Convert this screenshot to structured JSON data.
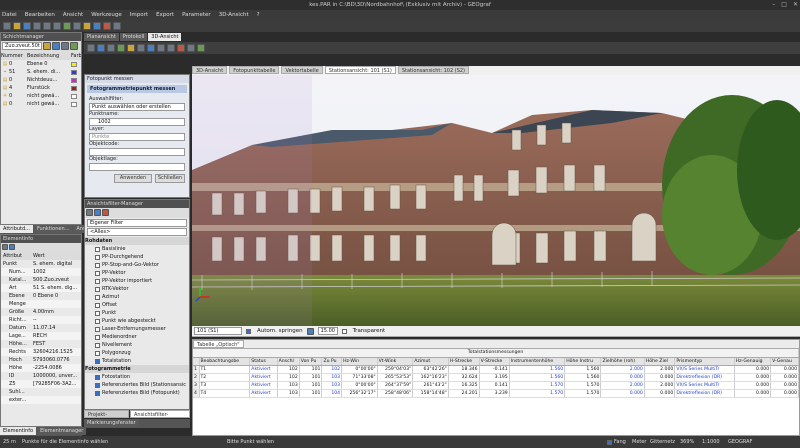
{
  "window": {
    "title": "kes.PAR in C:\\BD\\3D\\Nordbahnhof\\ (Exklusiv mit Archiv) - GEOgraf",
    "controls": [
      "–",
      "□",
      "✕"
    ]
  },
  "menu": [
    "Datei",
    "Bearbeiten",
    "Ansicht",
    "Werkzeuge",
    "Import",
    "Export",
    "Parameter",
    "3D-Ansicht",
    "?"
  ],
  "schichtmanager": {
    "title": "Schichtmanager",
    "combo": "Zuo.zveut.50t",
    "columns": [
      "Nummer",
      "Bezeichnung",
      "Farb"
    ],
    "rows": [
      {
        "num": "0",
        "name": "Ebene 0",
        "color": "#f2f207",
        "icon": "layer"
      },
      {
        "num": "51",
        "name": "S. ehem. di...",
        "color": "#2e3cd8",
        "icon": "pin"
      },
      {
        "num": "0",
        "name": "Nichtdeuu...",
        "color": "#d822d8",
        "icon": "layer"
      },
      {
        "num": "4",
        "name": "Flurstück",
        "color": "#9c2222",
        "icon": "layer"
      },
      {
        "num": "0",
        "name": "nicht gewä...",
        "color": "#ffffff",
        "icon": "bulb"
      },
      {
        "num": "0",
        "name": "nicht gewä...",
        "color": "#ffffff",
        "icon": "layer"
      }
    ]
  },
  "lefttabs": [
    "Attributd...",
    "Funktionen...",
    "Ansichtsf..."
  ],
  "elementinfo": {
    "title": "Elementinfo",
    "columns": [
      "Attribut",
      "Wert"
    ],
    "rows": [
      {
        "attr": "Punkt",
        "val": "S. ehem. digital"
      },
      {
        "attr": "Num...",
        "val": "1002"
      },
      {
        "attr": "Katal...",
        "val": "500.Zuo.zveut"
      },
      {
        "attr": "Art",
        "val": "51 S. ehem. dig..."
      },
      {
        "attr": "Ebene",
        "val": "0 Ebene 0"
      },
      {
        "attr": "Menge",
        "val": ""
      },
      {
        "attr": "Größe",
        "val": "4.00mm"
      },
      {
        "attr": "Richt...",
        "val": "--"
      },
      {
        "attr": "Datum",
        "val": "11.07.14"
      },
      {
        "attr": "Lage...",
        "val": "RECH"
      },
      {
        "attr": "Höhe...",
        "val": "FEST"
      },
      {
        "attr": "Rechts",
        "val": "32604216.1525"
      },
      {
        "attr": "Hoch",
        "val": "5793060.0776"
      },
      {
        "attr": "Höhe",
        "val": "-2254.0086"
      },
      {
        "attr": "ID",
        "val": "1000000, unver..."
      },
      {
        "attr": "Z5",
        "val": "[79285F06-3A2..."
      },
      {
        "attr": "Suhl...",
        "val": ""
      },
      {
        "attr": "exter...",
        "val": ""
      }
    ]
  },
  "bottomlefttabs": [
    "Elementinfo",
    "Elementmanager"
  ],
  "fotopunkt": {
    "title": "Fotopunkt messen",
    "section": "Fotogrammetriepunkt messen",
    "auswahl_label": "Auswahlfilter:",
    "auswahl": "Punkt auswählen oder erstellen",
    "punktname_label": "Punktname:",
    "punktname": "1002",
    "layer_label": "Layer:",
    "layer": "Punkte",
    "objektcode_label": "Objektcode:",
    "objektcode": "",
    "objektlage_label": "Objektlage:",
    "objektlage": "",
    "anwenden": "Anwenden",
    "schliessen": "Schließen"
  },
  "ansichtsfilter": {
    "title": "Ansichtsfilter-Manager",
    "filter": "Eigener Filter",
    "alles": "<Alles>",
    "group1": "Rohdaten",
    "items": [
      {
        "label": "Basislinie",
        "on": false
      },
      {
        "label": "PP-Durchgehend",
        "on": false
      },
      {
        "label": "PP-Stop-and-Go-Vektor",
        "on": false
      },
      {
        "label": "PP-Vektor",
        "on": false
      },
      {
        "label": "PP-Vektor importiert",
        "on": false
      },
      {
        "label": "RTK-Vektor",
        "on": false
      },
      {
        "label": "Azimut",
        "on": false
      },
      {
        "label": "Offset",
        "on": false
      },
      {
        "label": "Punkt",
        "on": false
      },
      {
        "label": "Punkt wie abgesteckt",
        "on": false
      },
      {
        "label": "Laser-Entfernungsmesser",
        "on": false
      },
      {
        "label": "Medienordner",
        "on": false
      },
      {
        "label": "Nivellement",
        "on": false
      },
      {
        "label": "Polygonzug",
        "on": false
      },
      {
        "label": "Totalstation",
        "on": true
      }
    ],
    "group2": "Fotogrammetrie",
    "items2": [
      {
        "label": "Fotostation",
        "on": true
      },
      {
        "label": "Referenziertes Bild (Stationsansic",
        "on": true
      },
      {
        "label": "Referenziertes Bild (Fotopunkt)",
        "on": true
      }
    ],
    "tabs": [
      "Projekt-Explorer",
      "Ansichtsfilter-Manager"
    ]
  },
  "doctabs": [
    "Planansicht",
    "Protokoll",
    "3D-Ansicht"
  ],
  "viewtabs": [
    "3D-Ansicht",
    "Fotopunkttabelle",
    "Vektortabelle",
    "Stationsansicht: 101 (S1)",
    "Stationsansicht: 102 (S2)"
  ],
  "imagecontrols": {
    "station": "101 (S1)",
    "autom_springen": "Autom. springen",
    "zoom": "15.00",
    "transparent": "Transparent"
  },
  "tabelle": {
    "tab": "Tabelle „Optisch\"",
    "group_header": "Totalstationsmessungen",
    "columns": [
      "Beobachtungsbe",
      "Status",
      "Anschl",
      "Von Pu",
      "Zu Pu",
      "Hz-Win",
      "Vt-Wink",
      "Azimut",
      "H-Strecke",
      "V-Strecke",
      "Instrumentenhöhe",
      "Höhe Instru",
      "Zielhöhe (roh)",
      "Höhe Ziel",
      "Prismentyp",
      "Hz-Genauig",
      "V-Genau"
    ],
    "rows": [
      {
        "sel": "1",
        "c": [
          "T1",
          "Aktiviert",
          "102",
          "101",
          "102",
          "0°00'00\"",
          "259°04'03\"",
          "63°42'26\"",
          "18.346",
          "-0.141",
          "1.560",
          "1.560",
          "2.000",
          "2.000",
          "VX/S Series MultiTr",
          "0.000",
          "0.000"
        ]
      },
      {
        "sel": "2",
        "c": [
          "T2",
          "Aktiviert",
          "102",
          "101",
          "103",
          "71°33'08\"",
          "265°53'53\"",
          "162°16'23\"",
          "32.624",
          "3.195",
          "1.560",
          "1.560",
          "0.000",
          "0.000",
          "Direktreflexion (DR)",
          "0.000",
          "0.000"
        ]
      },
      {
        "sel": "3",
        "c": [
          "T3",
          "Aktiviert",
          "103",
          "101",
          "103",
          "0°00'00\"",
          "264°37'59\"",
          "261°43'2\"",
          "16.325",
          "0.141",
          "1.570",
          "1.570",
          "2.000",
          "2.000",
          "VX/S Series MultiTr",
          "0.000",
          "0.000"
        ]
      },
      {
        "sel": "4",
        "c": [
          "T4",
          "Aktiviert",
          "103",
          "101",
          "104",
          "256°32'17\"",
          "258°48'06\"",
          "158°14'48\"",
          "24.201",
          "3.239",
          "1.570",
          "1.570",
          "0.000",
          "0.000",
          "Direktreflexion (DR)",
          "0.000",
          "0.000"
        ]
      }
    ]
  },
  "markierung": "Markierungsfenster",
  "status": {
    "scale": "25 m",
    "hint": "Punkte für die Elementinfo wählen",
    "mid": "Bitte Punkt wählen",
    "fang": "Fang",
    "meter": "Meter",
    "gitternetz": "Gitternetz",
    "zoom": "369%",
    "ratio": "1:1000",
    "app": "GEOGRAF"
  }
}
